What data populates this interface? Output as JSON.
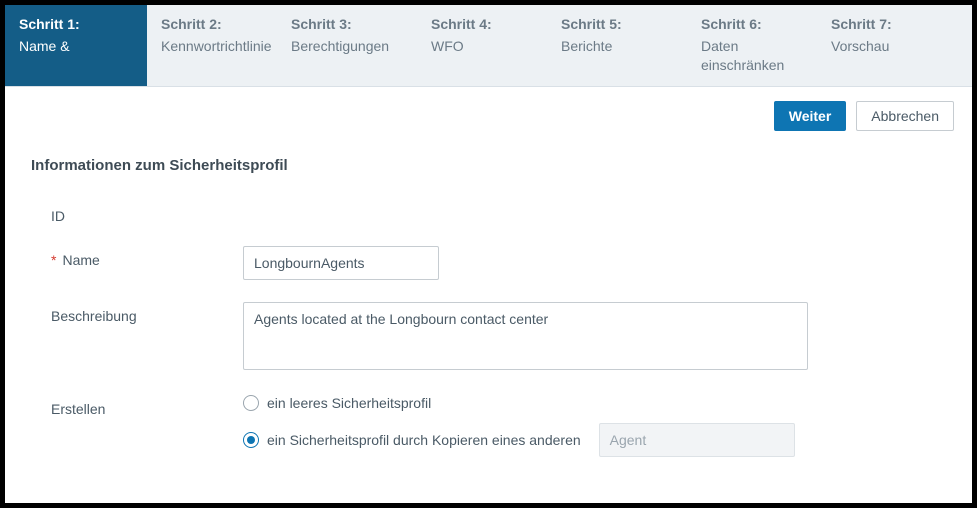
{
  "steps": [
    {
      "title": "Schritt 1:",
      "sub": "Name &"
    },
    {
      "title": "Schritt 2:",
      "sub": "Kennwortrichtlinie"
    },
    {
      "title": "Schritt 3:",
      "sub": "Berechtigungen"
    },
    {
      "title": "Schritt 4:",
      "sub": "WFO"
    },
    {
      "title": "Schritt 5:",
      "sub": "Berichte"
    },
    {
      "title": "Schritt 6:",
      "sub": "Daten einschränken"
    },
    {
      "title": "Schritt 7:",
      "sub": "Vorschau"
    }
  ],
  "actions": {
    "next": "Weiter",
    "cancel": "Abbrechen"
  },
  "form": {
    "section_title": "Informationen zum Sicherheitsprofil",
    "id_label": "ID",
    "name_label": "Name",
    "name_value": "LongbournAgents",
    "desc_label": "Beschreibung",
    "desc_value": "Agents located at the Longbourn contact center",
    "create_label": "Erstellen",
    "create_blank": "ein leeres Sicherheitsprofil",
    "create_copy": "ein Sicherheitsprofil durch Kopieren eines anderen",
    "copy_source": "Agent"
  }
}
